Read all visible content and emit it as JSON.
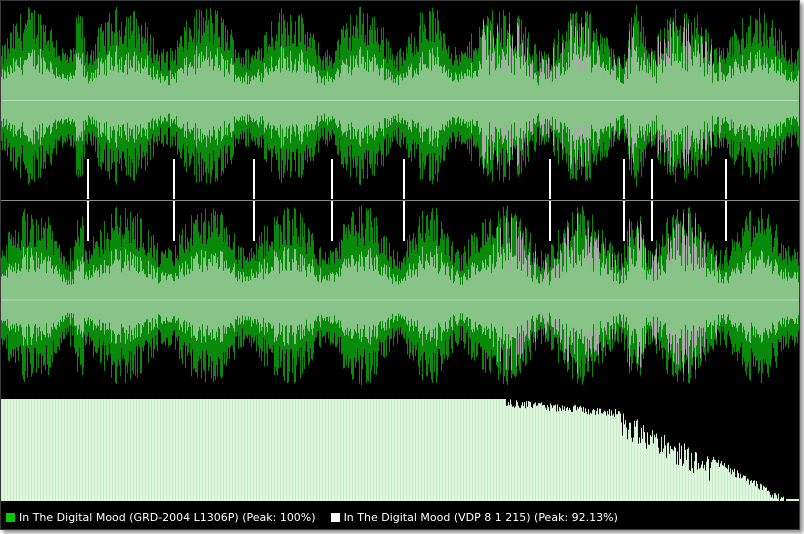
{
  "colors": {
    "background": "#000000",
    "waveform_a": "#0a8a0a",
    "waveform_b": "#a8a8a8",
    "overlap": "#88c488",
    "centerline": "#b8dcb8",
    "spectrum_fill": "#dff7df",
    "marker": "#ffffff",
    "legend_a": "#00cc00",
    "legend_b": "#ffffff"
  },
  "legend": {
    "track_a": {
      "label": "In The Digital Mood (GRD-2004 L1306P) (Peak: 100%)",
      "swatch_color": "#00cc00"
    },
    "track_b": {
      "label": "In The Digital Mood (VDP 8 1 215) (Peak: 92.13%)",
      "swatch_color": "#ffffff"
    }
  }
}
